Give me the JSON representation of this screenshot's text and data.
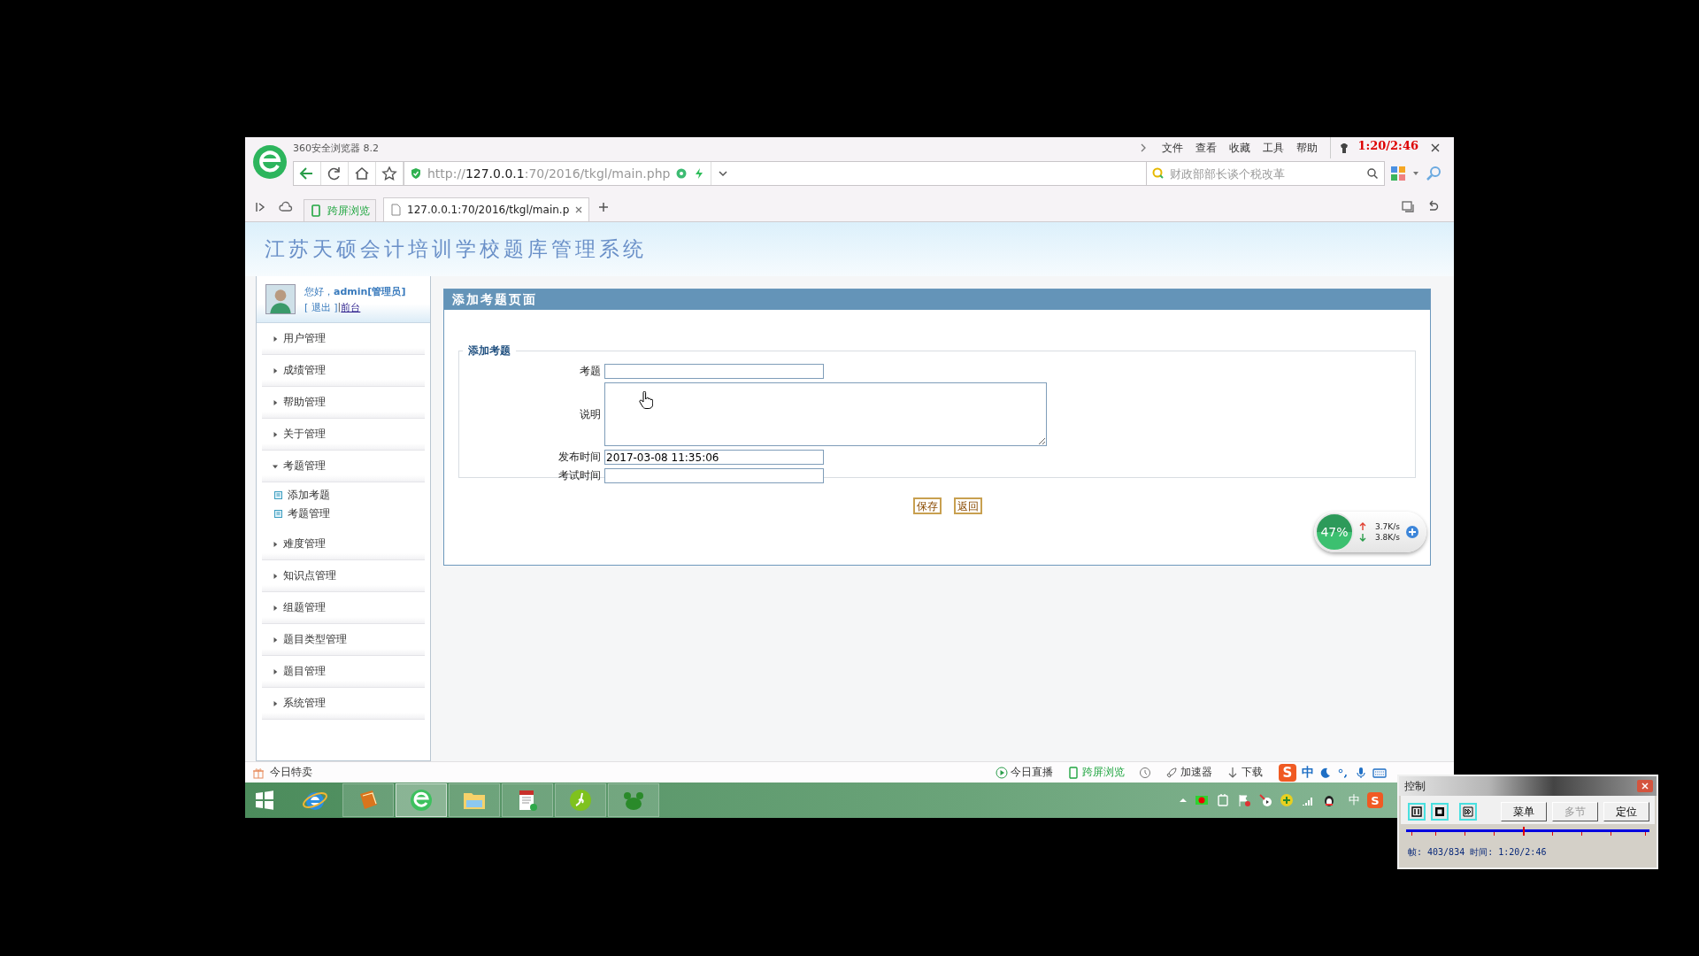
{
  "browser": {
    "title": "360安全浏览器 8.2",
    "menu": [
      "文件",
      "查看",
      "收藏",
      "工具",
      "帮助"
    ],
    "address": {
      "scheme": "http://",
      "host": "127.0.0.1",
      "path": ":70/2016/tkgl/main.php"
    },
    "search": {
      "placeholder": "财政部部长谈个税改革"
    },
    "tabs": [
      {
        "kind": "app",
        "label": "跨屏浏览",
        "selected": false
      },
      {
        "kind": "page",
        "label": "127.0.0.1:70/2016/tkgl/main.p",
        "selected": true
      }
    ]
  },
  "recording_time": "1:20/2:46",
  "page": {
    "site_title": "江苏天硕会计培训学校题库管理系统",
    "user": {
      "greeting": "您好，**admin[管理员]**",
      "logout": "[ 退出 ]",
      "separator": "|",
      "front": "前台"
    },
    "nav": [
      {
        "label": "用户管理",
        "expanded": false
      },
      {
        "label": "成绩管理",
        "expanded": false
      },
      {
        "label": "帮助管理",
        "expanded": false
      },
      {
        "label": "关于管理",
        "expanded": false
      },
      {
        "label": "考题管理",
        "expanded": true,
        "children": [
          {
            "label": "添加考题"
          },
          {
            "label": "考题管理"
          }
        ]
      },
      {
        "label": "难度管理",
        "expanded": false
      },
      {
        "label": "知识点管理",
        "expanded": false
      },
      {
        "label": "组题管理",
        "expanded": false
      },
      {
        "label": "题目类型管理",
        "expanded": false
      },
      {
        "label": "题目管理",
        "expanded": false
      },
      {
        "label": "系统管理",
        "expanded": false
      }
    ],
    "panel": {
      "title": "添加考题页面",
      "legend": "添加考题",
      "fields": [
        {
          "label": "考题",
          "kind": "text"
        },
        {
          "label": "说明",
          "kind": "textarea"
        },
        {
          "label": "发布时间",
          "kind": "text",
          "value": "2017-03-08 11:35:06"
        },
        {
          "label": "考试时间",
          "kind": "text"
        }
      ],
      "buttons": [
        "保存",
        "返回"
      ]
    }
  },
  "speed_widget": {
    "percent": "47%",
    "upload": "3.7K/s",
    "download": "3.8K/s"
  },
  "status_bar": {
    "left": "今日特卖",
    "items": [
      {
        "kind": "live",
        "label": "今日直播"
      },
      {
        "kind": "cross",
        "label": "跨屏浏览"
      },
      {
        "kind": "history"
      },
      {
        "kind": "boost",
        "label": "加速器"
      },
      {
        "kind": "download",
        "label": "下载"
      }
    ],
    "ime": {
      "logo": "S",
      "mode": "中"
    }
  },
  "taskbar": {
    "apps": [
      {
        "kind": "ie",
        "running": false,
        "active": false
      },
      {
        "kind": "book",
        "running": true,
        "active": false
      },
      {
        "kind": "browser",
        "running": true,
        "active": true
      },
      {
        "kind": "folder",
        "running": true,
        "active": false
      },
      {
        "kind": "notepad",
        "running": true,
        "active": false
      },
      {
        "kind": "dw",
        "running": true,
        "active": false
      },
      {
        "kind": "paw",
        "running": true,
        "active": false
      }
    ],
    "tray": {
      "ime": "中",
      "logo": "S"
    }
  },
  "player": {
    "title": "控制",
    "controls": [
      {
        "kind": "pause"
      },
      {
        "kind": "stop"
      },
      {
        "kind": "step"
      }
    ],
    "buttons": [
      {
        "label": "菜单",
        "disabled": false
      },
      {
        "label": "多节",
        "disabled": true
      },
      {
        "label": "定位",
        "disabled": false
      }
    ],
    "level": 0.48,
    "status": "帧: 403/834 时间: 1:20/2:46"
  }
}
